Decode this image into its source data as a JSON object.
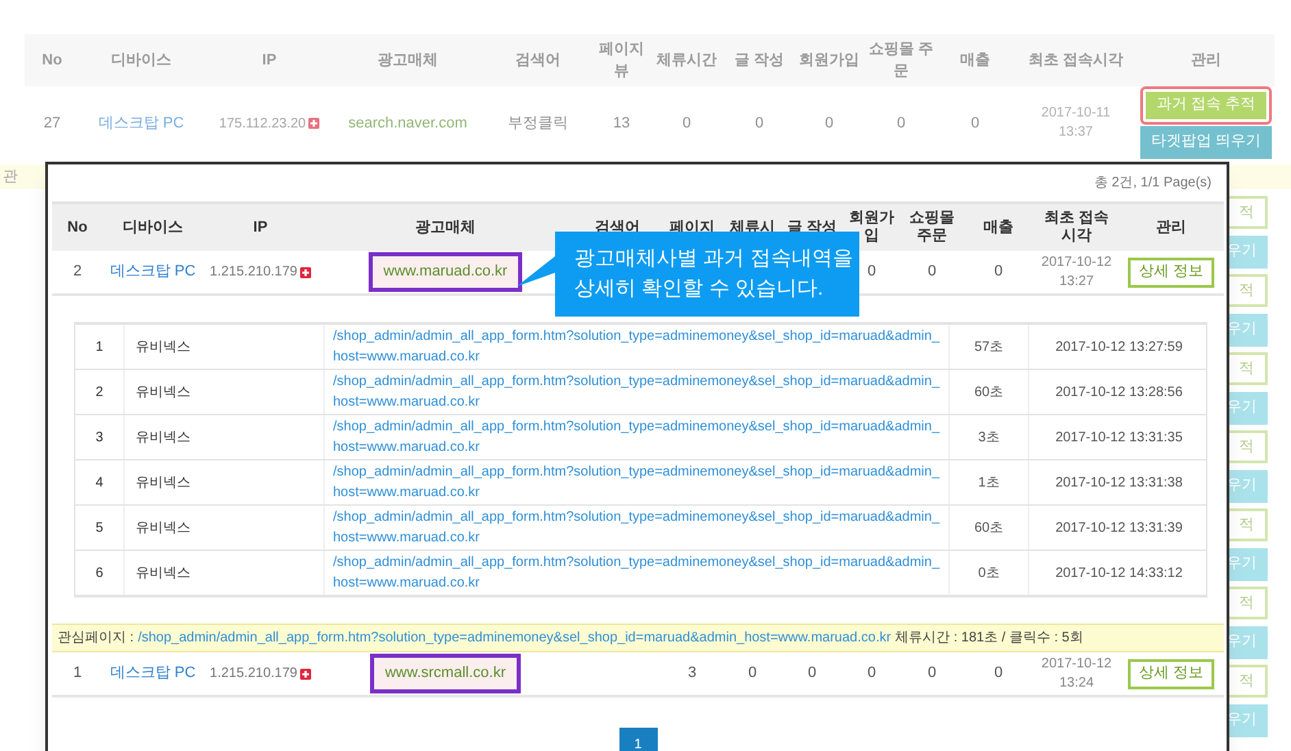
{
  "background": {
    "columns": [
      "No",
      "디바이스",
      "IP",
      "광고매체",
      "검색어",
      "페이지뷰",
      "체류시간",
      "글 작성",
      "회원가입",
      "쇼핑몰 주문",
      "매출",
      "최초 접속시각",
      "관리"
    ],
    "row": {
      "no": "27",
      "device": "데스크탑 PC",
      "ip": "175.112.23.20",
      "media": {
        "text": "search.naver.com",
        "highlighted": false
      },
      "keyword": "부정클릭",
      "pageviews": "13",
      "stay": "0",
      "posts": "0",
      "signups": "0",
      "orders": "0",
      "sales": "0",
      "first_visit": [
        "2017-10-11",
        "13:37"
      ],
      "buttons": [
        {
          "label": "과거 접속 추적",
          "kind": "trace",
          "highlighted": true
        },
        {
          "label": "타겟팝업 띄우기",
          "kind": "popup",
          "highlighted": false
        }
      ]
    },
    "band_fragment": "관",
    "side_buttons": [
      {
        "kind": "trace",
        "label": "적"
      },
      {
        "kind": "popup",
        "label": "우기"
      },
      {
        "kind": "trace",
        "label": "적"
      },
      {
        "kind": "popup",
        "label": "우기"
      },
      {
        "kind": "trace",
        "label": "적"
      },
      {
        "kind": "popup",
        "label": "우기"
      },
      {
        "kind": "trace",
        "label": "적"
      },
      {
        "kind": "popup",
        "label": "우기"
      },
      {
        "kind": "trace",
        "label": "적"
      },
      {
        "kind": "popup",
        "label": "우기"
      },
      {
        "kind": "trace",
        "label": "적"
      },
      {
        "kind": "popup",
        "label": "우기"
      },
      {
        "kind": "trace",
        "label": "적"
      },
      {
        "kind": "popup",
        "label": "우기"
      }
    ]
  },
  "popup": {
    "summary": "총 2건, 1/1 Page(s)",
    "columns": [
      "No",
      "디바이스",
      "IP",
      "광고매체",
      "검색어",
      "페이지",
      "체류시",
      "글 작성",
      "회원가입",
      "쇼핑몰 주문",
      "매출",
      "최초 접속시각",
      "관리"
    ],
    "rows": [
      {
        "no": "2",
        "device": "데스크탑 PC",
        "ip": "1.215.210.179",
        "media": {
          "text": "www.maruad.co.kr",
          "highlighted": true
        },
        "signups": "0",
        "orders": "0",
        "sales": "0",
        "first_visit": [
          "2017-10-12",
          "13:27"
        ],
        "action": "상세 정보",
        "details": [
          {
            "no": "1",
            "name": "유비넥스",
            "url": "/shop_admin/admin_all_app_form.htm?solution_type=adminemoney&sel_shop_id=maruad&admin_host=www.maruad.co.kr",
            "stay": "57초",
            "time": "2017-10-12 13:27:59"
          },
          {
            "no": "2",
            "name": "유비넥스",
            "url": "/shop_admin/admin_all_app_form.htm?solution_type=adminemoney&sel_shop_id=maruad&admin_host=www.maruad.co.kr",
            "stay": "60초",
            "time": "2017-10-12 13:28:56"
          },
          {
            "no": "3",
            "name": "유비넥스",
            "url": "/shop_admin/admin_all_app_form.htm?solution_type=adminemoney&sel_shop_id=maruad&admin_host=www.maruad.co.kr",
            "stay": "3초",
            "time": "2017-10-12 13:31:35"
          },
          {
            "no": "4",
            "name": "유비넥스",
            "url": "/shop_admin/admin_all_app_form.htm?solution_type=adminemoney&sel_shop_id=maruad&admin_host=www.maruad.co.kr",
            "stay": "1초",
            "time": "2017-10-12 13:31:38"
          },
          {
            "no": "5",
            "name": "유비넥스",
            "url": "/shop_admin/admin_all_app_form.htm?solution_type=adminemoney&sel_shop_id=maruad&admin_host=www.maruad.co.kr",
            "stay": "60초",
            "time": "2017-10-12 13:31:39"
          },
          {
            "no": "6",
            "name": "유비넥스",
            "url": "/shop_admin/admin_all_app_form.htm?solution_type=adminemoney&sel_shop_id=maruad&admin_host=www.maruad.co.kr",
            "stay": "0초",
            "time": "2017-10-12 14:33:12"
          }
        ],
        "interest": {
          "label": "관심페이지 :",
          "url": "/shop_admin/admin_all_app_form.htm?solution_type=adminemoney&sel_shop_id=maruad&admin_host=www.maruad.co.kr",
          "stats": "체류시간 : 181초 / 클릭수 : 5회"
        }
      },
      {
        "no": "1",
        "device": "데스크탑 PC",
        "ip": "1.215.210.179",
        "media": {
          "text": "www.srcmall.co.kr",
          "highlighted": true
        },
        "pageviews": "3",
        "stay": "0",
        "posts": "0",
        "signups": "0",
        "orders": "0",
        "sales": "0",
        "first_visit": [
          "2017-10-12",
          "13:24"
        ],
        "action": "상세 정보"
      }
    ],
    "callout": [
      "광고매체사별 과거 접속내역을",
      "상세히 확인할 수 있습니다."
    ],
    "pagination": [
      {
        "label": "1",
        "selected": true
      }
    ]
  }
}
